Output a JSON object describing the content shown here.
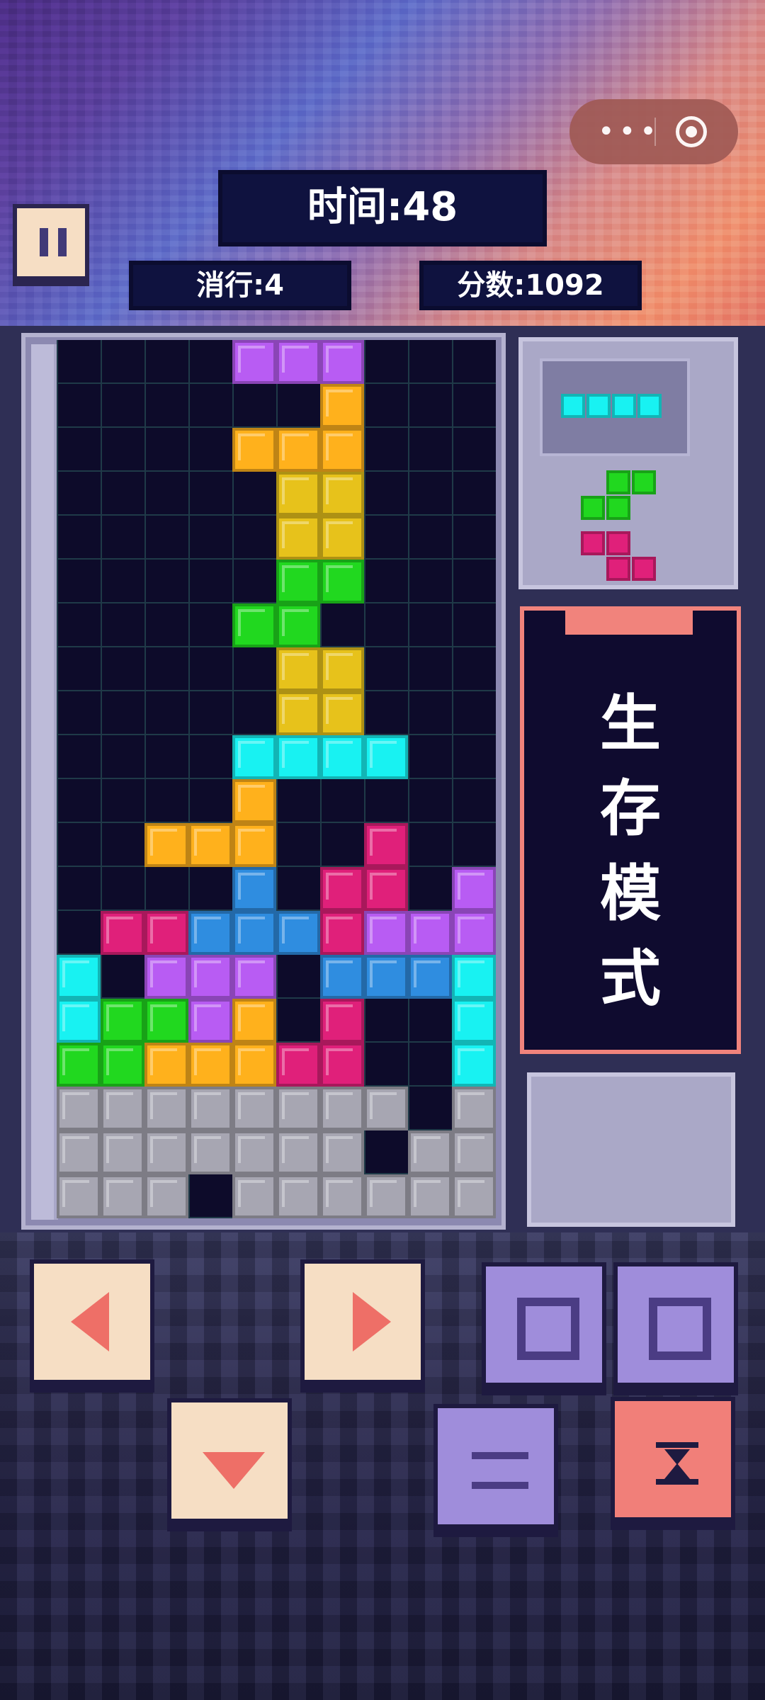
{
  "hud": {
    "time_label": "时间:48",
    "lines_label": "消行:4",
    "score_label": "分数:1092"
  },
  "mode": {
    "title_lines": [
      "生",
      "存",
      "模",
      "式"
    ]
  },
  "next": {
    "pieces": [
      "I",
      "S",
      "Z"
    ]
  },
  "board": {
    "cols": 10,
    "rows": 20,
    "colors": {
      "purple": "#b85cf3",
      "orange": "#ffb11c",
      "yellow": "#e7c21b",
      "green": "#21d81f",
      "cyan": "#18f2f2",
      "magenta": "#e0207a",
      "blue": "#2f8de0",
      "gray": "#a7a6b2",
      "empty": "#0d0b2a"
    },
    "grid": [
      "....ppp...",
      "......o...",
      "....ooo...",
      ".....yy...",
      ".....yy...",
      ".....gg...",
      "....gg....",
      ".....yy...",
      ".....yy...",
      "....cccc..",
      "....o.....",
      "..ooo..m..",
      "....b.mm.p",
      ".mmbbbmppp",
      "c.ppp.bbbc",
      "cggpo.m..c",
      "ggooomm..c",
      "GGGGGGGG.G",
      "GGGGGGG.GG",
      "GGG.GGGGGG"
    ]
  },
  "controls": {
    "left": "left-arrow",
    "right": "right-arrow",
    "rotate_ccw": "rotate-ccw",
    "rotate_cw": "rotate-cw",
    "down": "soft-drop",
    "swap": "swap",
    "drop": "hard-drop"
  }
}
